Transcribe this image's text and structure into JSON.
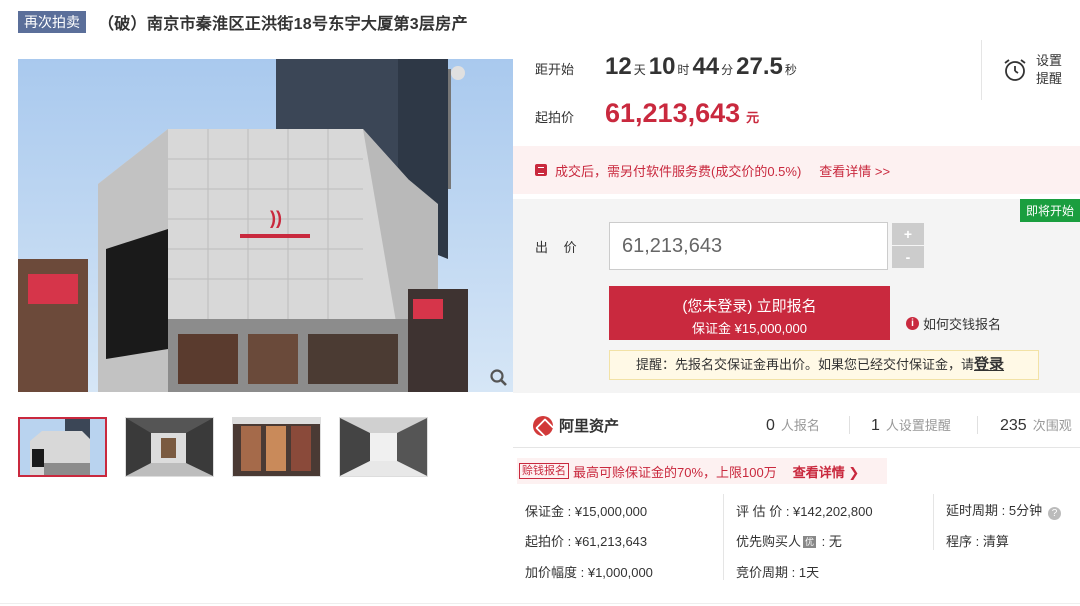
{
  "title": {
    "tag": "再次拍卖",
    "text": "（破）南京市秦淮区正洪街18号东宇大厦第3层房产"
  },
  "countdown": {
    "label": "距开始",
    "days": "12",
    "days_unit": "天",
    "hours": "10",
    "hours_unit": "时",
    "minutes": "44",
    "minutes_unit": "分",
    "seconds": "27.5",
    "seconds_unit": "秒"
  },
  "remind": {
    "line1": "设置",
    "line2": "提醒",
    "icon": "alarm-clock-icon"
  },
  "start_price": {
    "label": "起拍价",
    "value": "61,213,643",
    "unit": "元"
  },
  "fee_notice": {
    "text": "成交后，需另付软件服务费(成交价的0.5%)",
    "link": "查看详情 >>"
  },
  "bid": {
    "badge": "即将开始",
    "label": "出 价",
    "input_value": "61,213,643",
    "plus": "+",
    "minus": "-",
    "signup_main": "(您未登录) 立即报名",
    "signup_sub": "保证金 ¥15,000,000",
    "howto": "如何交钱报名",
    "tip_text": "提醒：先报名交保证金再出价。如果您已经交付保证金，请",
    "tip_login": "登录"
  },
  "stats": {
    "brand": "阿里资产",
    "signups": "0",
    "signups_label": "人报名",
    "reminders": "1",
    "reminders_label": "人设置提醒",
    "views": "235",
    "views_label": "次围观"
  },
  "promo": {
    "tag": "赊钱报名",
    "text": "最高可赊保证金的70%，上限100万",
    "link": "查看详情 ❯"
  },
  "info": {
    "deposit": "保证金 : ¥15,000,000",
    "appraisal": "评 估 价 : ¥142,202,800",
    "delay": "延时周期 : 5分钟",
    "start": "起拍价 : ¥61,213,643",
    "preempt_label": "优先购买人",
    "preempt_badge": "优",
    "preempt_value": " : 无",
    "procedure": "程序 : 清算",
    "increment": "加价幅度 : ¥1,000,000",
    "cycle": "竞价周期 : 1天"
  },
  "colors": {
    "accent": "#c9293e",
    "green_badge": "#1a9e3f",
    "tag_blue": "#5b6f9a"
  }
}
